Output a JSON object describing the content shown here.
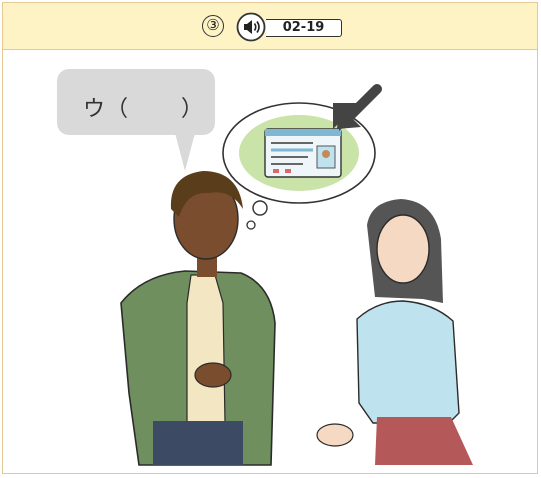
{
  "header": {
    "question_number": "③",
    "audio_icon": "speaker-icon",
    "track": "02-19"
  },
  "speech_bubble": {
    "text": "ウ（",
    "close_paren": "）"
  },
  "thought_bubble": {
    "content": "id-card-icon",
    "pointer": "arrow-icon"
  },
  "colors": {
    "header_bg": "#fdf3c4",
    "border": "#e6c896",
    "man_jacket": "#6f8f5f",
    "woman_top": "#bfe3ee",
    "woman_skirt": "#b5585a",
    "thought_fill": "#c9e3a8"
  }
}
